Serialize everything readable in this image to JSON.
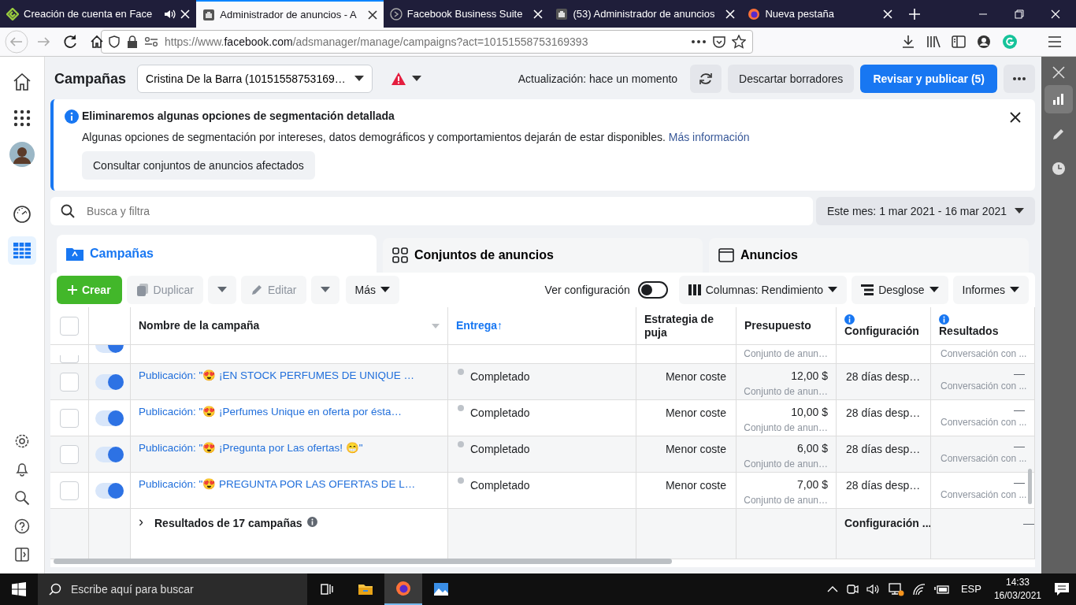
{
  "browser": {
    "tabs": [
      {
        "label": "Creación de cuenta en Face",
        "selected": false,
        "kind": "platzi",
        "audio": true
      },
      {
        "label": "Administrador de anuncios - A",
        "selected": true,
        "kind": "ads",
        "audio": false
      },
      {
        "label": "Facebook Business Suite",
        "selected": false,
        "kind": "suite",
        "audio": false
      },
      {
        "label": "(53) Administrador de anuncios",
        "selected": false,
        "kind": "ads",
        "audio": false
      },
      {
        "label": "Nueva pestaña",
        "selected": false,
        "kind": "firefox",
        "audio": false
      }
    ],
    "url": {
      "scheme": "https://www.",
      "domain": "facebook.com",
      "path": "/adsmanager/manage/campaigns?act=10151558753169393"
    }
  },
  "nav_rail": [
    {
      "kind": "home",
      "selected": false
    },
    {
      "kind": "apps",
      "selected": false
    },
    {
      "kind": "avatar",
      "selected": false
    },
    {
      "kind": "gauge",
      "selected": false
    },
    {
      "kind": "table",
      "selected": true
    }
  ],
  "nav_rail_bottom": [
    {
      "kind": "settings"
    },
    {
      "kind": "bell"
    },
    {
      "kind": "search"
    },
    {
      "kind": "help"
    },
    {
      "kind": "panel"
    }
  ],
  "header": {
    "title": "Campañas",
    "account": "Cristina De la Barra (10151558753169…",
    "warning": true,
    "update_status": "Actualización: hace un momento",
    "discard_button": "Descartar borradores",
    "publish_button": "Revisar y publicar (5)"
  },
  "notice": {
    "title": "Eliminaremos algunas opciones de segmentación detallada",
    "body": "Algunas opciones de segmentación por intereses, datos demográficos y comportamientos dejarán de estar disponibles.",
    "link": "Más información",
    "button": "Consultar conjuntos de anuncios afectados"
  },
  "search": {
    "placeholder": "Busca y filtra"
  },
  "date_range": "Este mes: 1 mar 2021 - 16 mar 2021",
  "level_tabs": [
    {
      "label": "Campañas",
      "kind": "campaign",
      "selected": true
    },
    {
      "label": "Conjuntos de anuncios",
      "kind": "adset",
      "selected": false
    },
    {
      "label": "Anuncios",
      "kind": "ad",
      "selected": false
    }
  ],
  "toolbar": {
    "create": "Crear",
    "duplicate": "Duplicar",
    "edit": "Editar",
    "more": "Más",
    "view_setting": "Ver configuración",
    "view_setting_on": false,
    "columns": "Columnas: Rendimiento",
    "breakdown": "Desglose",
    "reports": "Informes"
  },
  "table": {
    "select_all_checked": false,
    "columns": [
      {
        "label": "Nombre de la campaña",
        "sorted": false,
        "info": false
      },
      {
        "label": "Entrega",
        "sorted": true,
        "sort_arrow": "↑",
        "info": false
      },
      {
        "label": "Estrategia de puja",
        "sorted": false,
        "info": false
      },
      {
        "label": "Presupuesto",
        "sorted": false,
        "info": false
      },
      {
        "label": "Configuración",
        "sorted": false,
        "info": true
      },
      {
        "label": "Resultados",
        "sorted": false,
        "info": true
      }
    ],
    "rows": [
      {
        "kind": "partial",
        "checked": false,
        "on": true,
        "budget_note": "Conjunto de anun…",
        "results_note": "Conversación con ..."
      },
      {
        "kind": "full",
        "checked": false,
        "on": true,
        "name": "Publicación: \"😍 ¡EN STOCK PERFUMES DE UNIQUE …",
        "delivery": "Completado",
        "bid_strategy": "Menor coste",
        "budget": "12,00 $",
        "budget_note": "Conjunto de anun…",
        "attribution": "28 días desp…",
        "results": "—",
        "results_note": "Conversación con ..."
      },
      {
        "kind": "full",
        "checked": false,
        "on": true,
        "name": "Publicación: \"😍 ¡Perfumes Unique en oferta por ésta…",
        "delivery": "Completado",
        "bid_strategy": "Menor coste",
        "budget": "10,00 $",
        "budget_note": "Conjunto de anun…",
        "attribution": "28 días desp…",
        "results": "—",
        "results_note": "Conversación con ..."
      },
      {
        "kind": "full",
        "checked": false,
        "on": true,
        "name": "Publicación: \"😍 ¡Pregunta por Las ofertas! 😁\"",
        "delivery": "Completado",
        "bid_strategy": "Menor coste",
        "budget": "6,00 $",
        "budget_note": "Conjunto de anun…",
        "attribution": "28 días desp…",
        "results": "—",
        "results_note": "Conversación con ..."
      },
      {
        "kind": "full",
        "checked": false,
        "on": true,
        "name": "Publicación: \"😍 PREGUNTA POR LAS OFERTAS DE L…",
        "delivery": "Completado",
        "bid_strategy": "Menor coste",
        "budget": "7,00 $",
        "budget_note": "Conjunto de anun…",
        "attribution": "28 días desp…",
        "results": "—",
        "results_note": "Conversación con ..."
      }
    ],
    "summary": {
      "expand": "›",
      "label": "Resultados de 17 campañas",
      "attribution": "Configuración ...",
      "results": "—"
    }
  },
  "side_panel": [
    {
      "kind": "chart",
      "selected": true
    },
    {
      "kind": "pencil",
      "selected": false
    },
    {
      "kind": "clock",
      "selected": false
    }
  ],
  "taskbar": {
    "search_placeholder": "Escribe aquí para buscar",
    "apps": [
      {
        "kind": "taskview",
        "selected": false
      },
      {
        "kind": "explorer",
        "selected": false
      },
      {
        "kind": "firefox",
        "selected": true
      },
      {
        "kind": "photos",
        "selected": false
      }
    ],
    "language": "ESP",
    "time": "14:33",
    "date": "16/03/2021"
  }
}
